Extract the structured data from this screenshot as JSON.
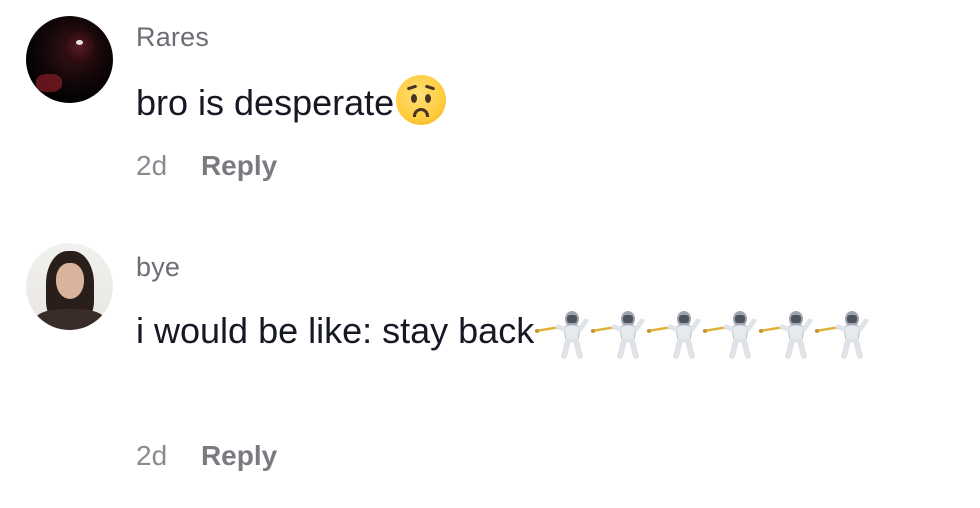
{
  "comments": [
    {
      "username": "Rares",
      "text": "bro is desperate",
      "emoji": "worried-face-icon",
      "time": "2d",
      "reply_label": "Reply"
    },
    {
      "username": "bye",
      "text": "i would be like: stay back",
      "emoji": "person-fencing-icon",
      "emoji_count": 6,
      "time": "2d",
      "reply_label": "Reply"
    }
  ],
  "colors": {
    "username": "#6c6e75",
    "text": "#161823",
    "meta": "#8a8b91"
  }
}
